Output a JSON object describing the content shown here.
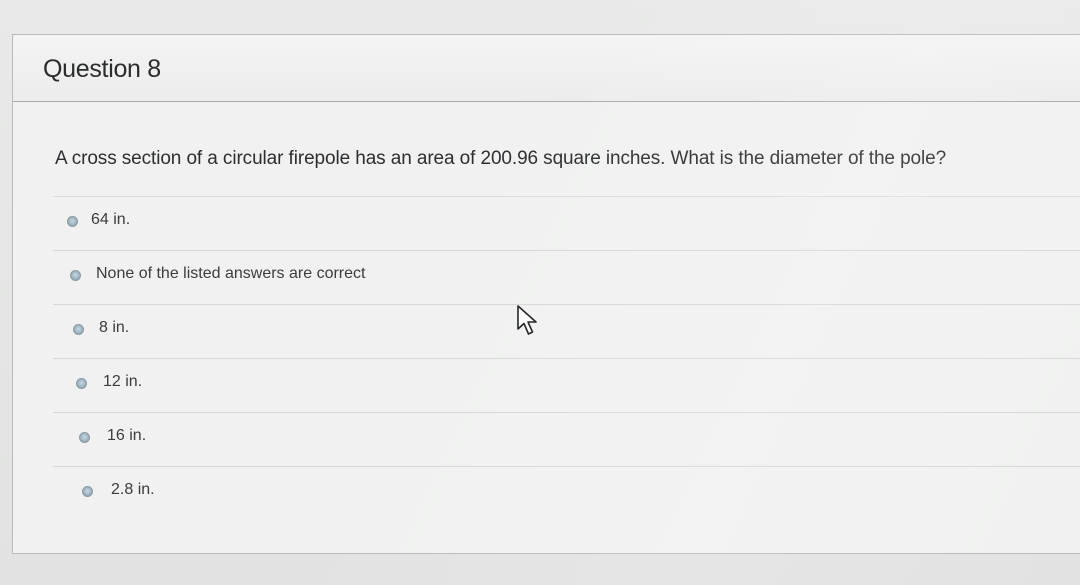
{
  "question": {
    "title": "Question 8",
    "text": "A cross section of a circular firepole has an area of 200.96 square inches. What is the diameter of the pole?"
  },
  "answers": [
    {
      "label": "64 in."
    },
    {
      "label": "None of the listed answers are correct"
    },
    {
      "label": "8 in."
    },
    {
      "label": "12 in."
    },
    {
      "label": "16 in."
    },
    {
      "label": "2.8 in."
    }
  ],
  "colors": {
    "page_background": "#e4e5e4",
    "card_background": "#f0f1f0",
    "radio_fill": "#9fb4c2",
    "text": "#2c2e31"
  },
  "icons": {
    "cursor": "mouse-pointer-icon",
    "radio": "radio-button-icon"
  }
}
